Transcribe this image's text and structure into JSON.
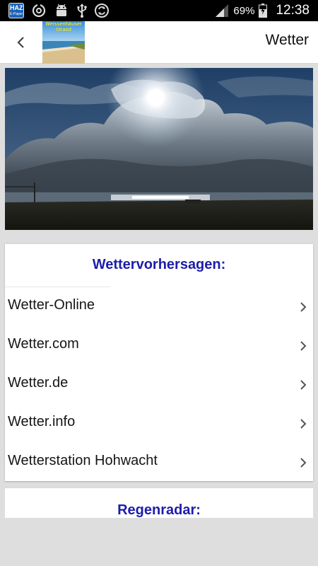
{
  "status_bar": {
    "haz_icon_text": "HAZ",
    "haz_icon_subtext": "E-Paper",
    "battery": "69%",
    "time": "12:38"
  },
  "action_bar": {
    "logo_text": "Weissenhäuser Strand",
    "title": "Wetter"
  },
  "forecast_section": {
    "title": "Wettervorhersagen:",
    "items": [
      {
        "label": "Wetter-Online"
      },
      {
        "label": "Wetter.com"
      },
      {
        "label": "Wetter.de"
      },
      {
        "label": "Wetter.info"
      },
      {
        "label": "Wetterstation Hohwacht"
      }
    ]
  },
  "radar_section": {
    "title": "Regenradar:"
  },
  "colors": {
    "section_title": "#1d1dab",
    "status_bar": "#000000",
    "background": "#dedede"
  },
  "icons": [
    "haz-app-icon",
    "sync-icon",
    "android-icon",
    "usb-icon",
    "refresh-icon",
    "signal-icon",
    "battery-icon",
    "back-chevron-icon",
    "chevron-right-icon"
  ]
}
